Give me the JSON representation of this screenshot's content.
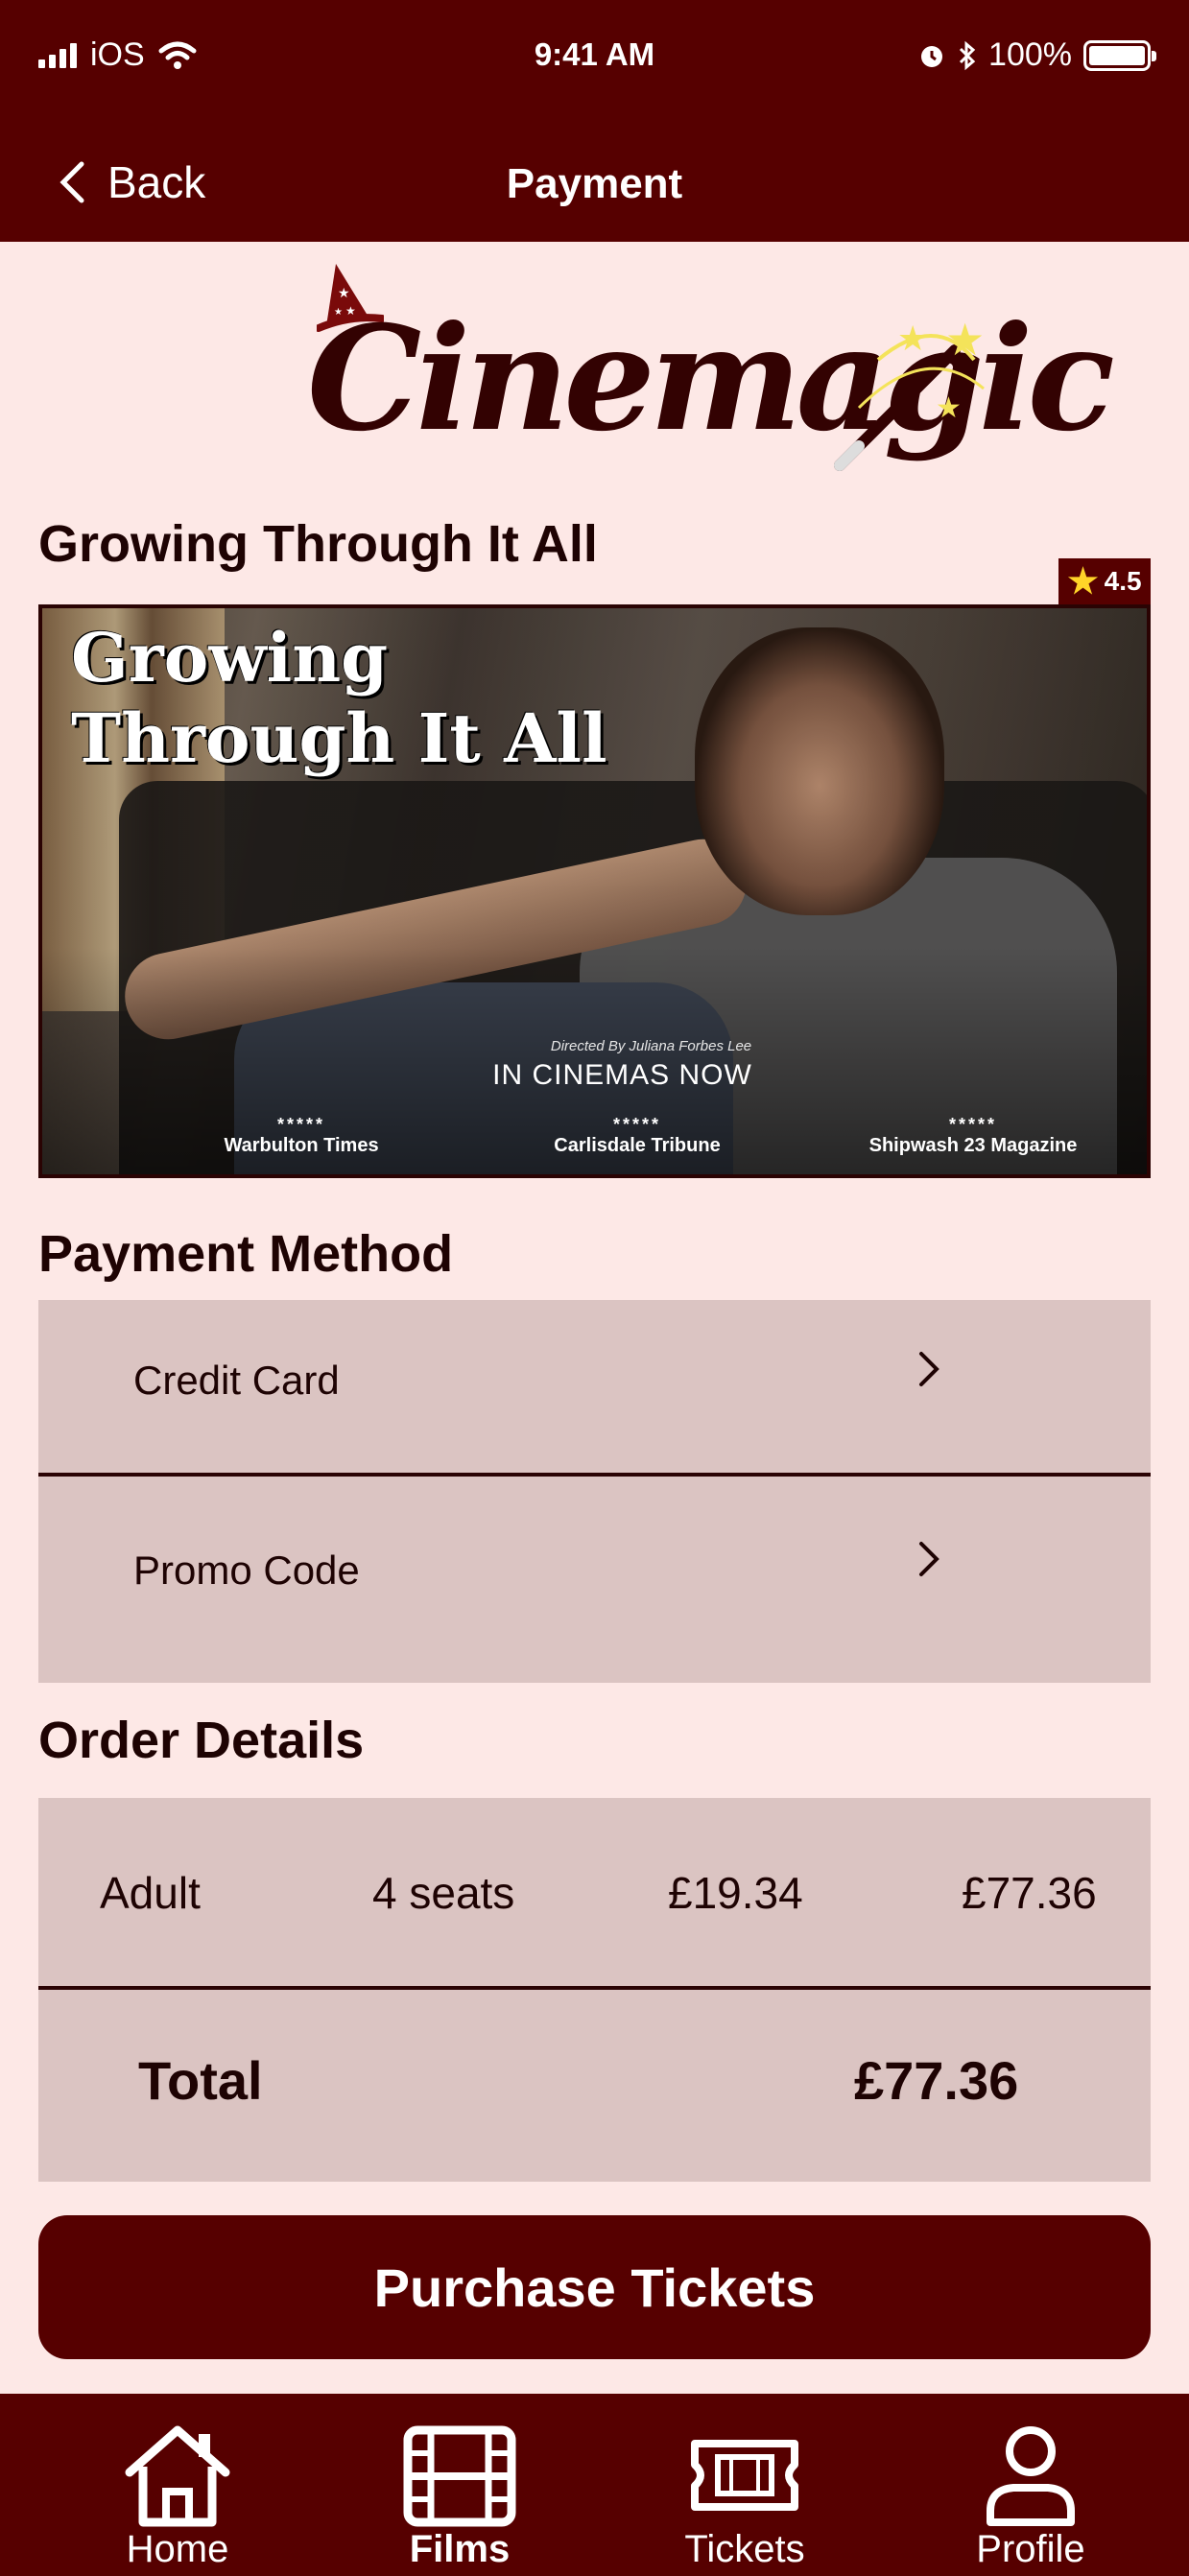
{
  "status_bar": {
    "carrier": "iOS",
    "time": "9:41 AM",
    "battery": "100%"
  },
  "nav": {
    "back_label": "Back",
    "title": "Payment"
  },
  "brand": {
    "logo_text": "Cinemagic"
  },
  "film": {
    "title": "Growing Through It All",
    "rating": "4.5",
    "poster": {
      "title_line1": "Growing",
      "title_line2": "Through It All",
      "director": "Directed By Juliana Forbes Lee",
      "tagline": "IN CINEMAS NOW",
      "reviews": [
        {
          "stars": "*****",
          "source": "Warbulton Times"
        },
        {
          "stars": "*****",
          "source": "Carlisdale Tribune"
        },
        {
          "stars": "*****",
          "source": "Shipwash 23 Magazine"
        }
      ]
    }
  },
  "payment_method": {
    "heading": "Payment Method",
    "options": [
      {
        "label": "Credit Card"
      },
      {
        "label": "Promo Code"
      }
    ]
  },
  "order": {
    "heading": "Order Details",
    "line": {
      "ticket_type": "Adult",
      "seats": "4 seats",
      "unit_price": "£19.34",
      "subtotal": "£77.36"
    },
    "total_label": "Total",
    "total_value": "£77.36"
  },
  "purchase_label": "Purchase Tickets",
  "tabs": [
    {
      "label": "Home",
      "icon": "home-icon",
      "active": false
    },
    {
      "label": "Films",
      "icon": "film-icon",
      "active": true
    },
    {
      "label": "Tickets",
      "icon": "ticket-icon",
      "active": false
    },
    {
      "label": "Profile",
      "icon": "profile-icon",
      "active": false
    }
  ],
  "colors": {
    "primary": "#560000",
    "background": "#fde8e6",
    "panel": "#dbc4c2",
    "star": "#ffd428"
  }
}
